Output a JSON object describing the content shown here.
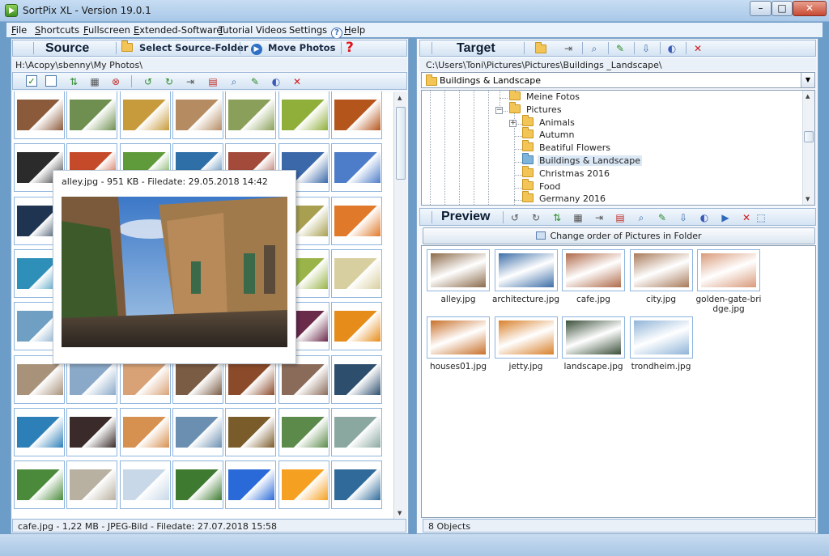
{
  "window": {
    "title": "SortPix XL - Version 19.0.1",
    "buttons": {
      "minimize": "–",
      "maximize": "□",
      "close": "✕"
    }
  },
  "menu": [
    {
      "label": "File",
      "underline": "F",
      "rest": "ile"
    },
    {
      "label": "Shortcuts",
      "underline": "S",
      "rest": "hortcuts"
    },
    {
      "label": "Fullscreen",
      "underline": "F",
      "rest": "ullscreen"
    },
    {
      "label": "Extended-Software",
      "underline": "E",
      "rest": "xtended-Software"
    },
    {
      "label": "Tutorial Videos",
      "underline": "T",
      "rest": "utorial Videos"
    },
    {
      "label": "Settings",
      "underline": "",
      "rest": "Settings"
    },
    {
      "label": "Help",
      "underline": "H",
      "rest": "elp"
    }
  ],
  "source": {
    "title": "Source",
    "select_folder_label": "Select Source-Folder",
    "move_photos_label": "Move Photos",
    "help_glyph": "?",
    "path": "H:\\Acopy\\sbenny\\My Photos\\",
    "toolbar_icons": [
      "check-all-icon",
      "uncheck-all-icon",
      "sort-icon",
      "grid-view-icon",
      "delete-circle-icon",
      "rotate-left-icon",
      "rotate-right-icon",
      "resize-icon",
      "file-info-icon",
      "zoom-icon",
      "edit-icon",
      "web-icon",
      "delete-icon"
    ],
    "status": "cafe.jpg - 1,22 MB - JPEG-Bild - Filedate: 27.07.2018 15:58",
    "thumb_colors": [
      [
        "#8b5a3a",
        "#6e8f4f",
        "#c79a3b",
        "#b58b62",
        "#8aa05a",
        "#8fae3a",
        "#b4551c"
      ],
      [
        "#2b2b2b",
        "#c54a2a",
        "#5f9b3b",
        "#2f6fa8",
        "#a34a3b",
        "#3b68a8",
        "#4d7cc8"
      ],
      [
        "#1f3450",
        "#7a9bc2",
        "#4b7f3b",
        "#7a4f2b",
        "#e08a2b",
        "#a8a050",
        "#e0792a"
      ],
      [
        "#2e8fb8",
        "#b86a3a",
        "#6a4b9a",
        "#4c8c5a",
        "#a87a4a",
        "#9ab44a",
        "#d8cfa0"
      ],
      [
        "#6f9fc2",
        "#3d6b9a",
        "#f2c75c",
        "#7d6b4b",
        "#2b6a7a",
        "#6a2a4a",
        "#e58c1a"
      ],
      [
        "#a8927a",
        "#8aa9c8",
        "#d9a276",
        "#7a5b44",
        "#8b4b2a",
        "#8a6b5a",
        "#2d4f6d"
      ],
      [
        "#2d7fb8",
        "#3a2a2a",
        "#d69050",
        "#6a8fb0",
        "#7a5b2a",
        "#5b8a4a",
        "#8aa8a0"
      ],
      [
        "#4a8a3a",
        "#b8b0a0",
        "#c8d8e8",
        "#3e7a2f",
        "#2a6ad8",
        "#f5a020",
        "#2f6a9a"
      ]
    ],
    "popup": {
      "caption": "alley.jpg - 951 KB - Filedate: 29.05.2018 14:42"
    }
  },
  "target": {
    "title": "Target",
    "path": "C:\\Users\\Toni\\Pictures\\Pictures\\Buildings _Landscape\\",
    "selected_folder": "Buildings & Landscape",
    "toolbar_icons": [
      "new-folder-icon",
      "rename-icon",
      "search-icon",
      "edit-icon",
      "move-icon",
      "web-icon",
      "delete-icon"
    ],
    "tree": [
      {
        "label": "Meine Fotos",
        "level": 1,
        "expander": ""
      },
      {
        "label": "Pictures",
        "level": 1,
        "expander": "−"
      },
      {
        "label": "Animals",
        "level": 2,
        "expander": "+"
      },
      {
        "label": "Autumn",
        "level": 2,
        "expander": ""
      },
      {
        "label": "Beatiful Flowers",
        "level": 2,
        "expander": ""
      },
      {
        "label": "Buildings & Landscape",
        "level": 2,
        "expander": "",
        "selected": true
      },
      {
        "label": "Christmas 2016",
        "level": 2,
        "expander": ""
      },
      {
        "label": "Food",
        "level": 2,
        "expander": ""
      },
      {
        "label": "Germany 2016",
        "level": 2,
        "expander": ""
      }
    ]
  },
  "preview": {
    "title": "Preview",
    "order_button": "Change order of Pictures in Folder",
    "toolbar_icons": [
      "rotate-left-icon",
      "rotate-right-icon",
      "sort-icon",
      "grid-view-icon",
      "resize-icon",
      "file-info-icon",
      "zoom-icon",
      "edit-icon",
      "move-icon",
      "web-icon",
      "slideshow-icon",
      "delete-icon",
      "select-icon"
    ],
    "items": [
      {
        "name": "alley.jpg",
        "color": "#8b6a4a"
      },
      {
        "name": "architecture.jpg",
        "color": "#3d6ea8"
      },
      {
        "name": "cafe.jpg",
        "color": "#b06a4a"
      },
      {
        "name": "city.jpg",
        "color": "#a87a5a"
      },
      {
        "name": "golden-gate-bri dge.jpg",
        "label_lines": [
          "golden-gate-bri",
          "dge.jpg"
        ],
        "color": "#d99a7a"
      },
      {
        "name": "houses01.jpg",
        "color": "#c8702a"
      },
      {
        "name": "jetty.jpg",
        "color": "#d8802a"
      },
      {
        "name": "landscape.jpg",
        "color": "#3a4f3a"
      },
      {
        "name": "trondheim.jpg",
        "color": "#8fb4d8"
      }
    ],
    "status": "8 Objects"
  }
}
